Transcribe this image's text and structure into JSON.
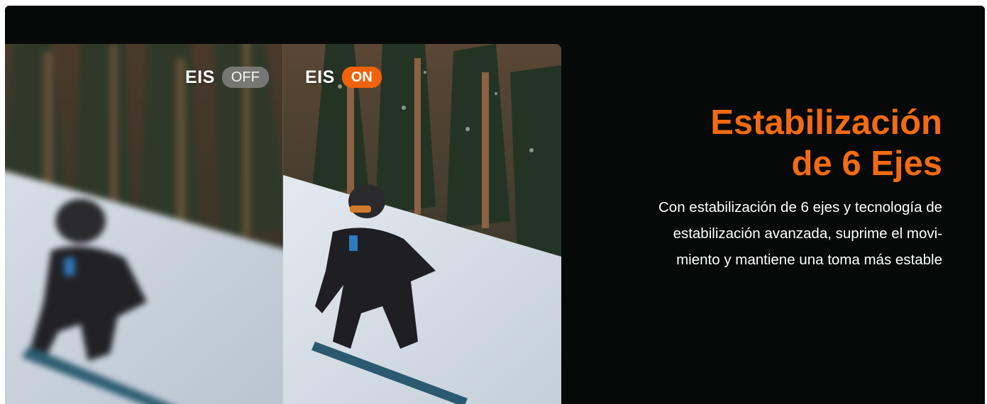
{
  "comparison": {
    "off": {
      "label": "EIS",
      "state": "OFF"
    },
    "on": {
      "label": "EIS",
      "state": "ON"
    }
  },
  "feature": {
    "title_line1": "Estabilización",
    "title_line2": "de 6 Ejes",
    "desc_line1": "Con estabilización de 6 ejes y tecnología de",
    "desc_line2": "estabilización avanzada, suprime el movi-",
    "desc_line3": "miento y mantiene una toma más estable"
  },
  "colors": {
    "background": "#070909",
    "accent": "#f26b12",
    "on_pill": "#f0620c",
    "off_pill": "#828282"
  }
}
